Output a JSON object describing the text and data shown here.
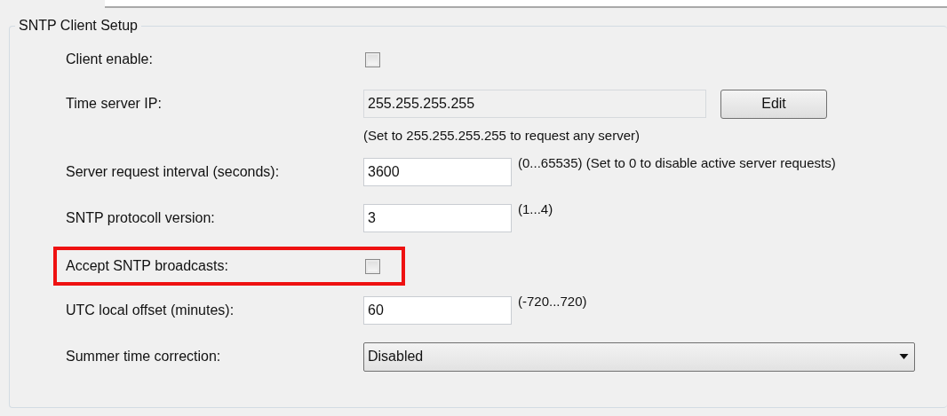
{
  "group": {
    "title": "SNTP Client Setup",
    "rows": [
      {
        "kind": "checkbox",
        "label": "Client enable:",
        "checked": false,
        "highlighted": false
      },
      {
        "kind": "readonly",
        "label": "Time server IP:",
        "value": "255.255.255.255",
        "button": "Edit",
        "highlighted": false
      },
      {
        "kind": "hint",
        "text": "(Set to 255.255.255.255 to request any server)",
        "highlighted": false
      },
      {
        "kind": "number",
        "label": "Server request interval (seconds):",
        "value": "3600",
        "note": "(0...65535) (Set to 0 to disable active server requests)",
        "highlighted": false
      },
      {
        "kind": "number",
        "label": "SNTP protocoll version:",
        "value": "3",
        "note": "(1...4)",
        "highlighted": false
      },
      {
        "kind": "checkbox",
        "label": "Accept SNTP broadcasts:",
        "checked": false,
        "highlighted": true
      },
      {
        "kind": "number",
        "label": "UTC local offset (minutes):",
        "value": "60",
        "note": "(-720...720)",
        "highlighted": false
      },
      {
        "kind": "select",
        "label": "Summer time correction:",
        "value": "Disabled",
        "highlighted": false
      }
    ]
  }
}
